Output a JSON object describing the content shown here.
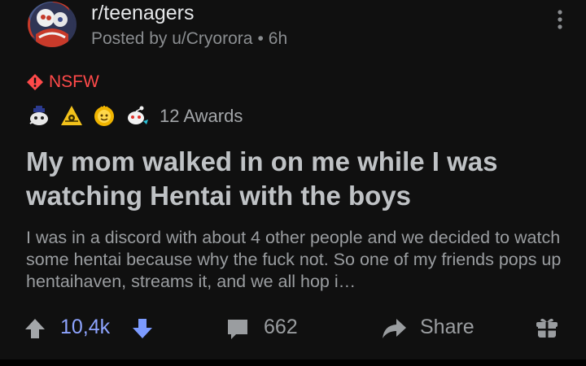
{
  "header": {
    "subreddit": "r/teenagers",
    "posted_by_prefix": "Posted by u/Cryorora",
    "separator": "•",
    "age": "6h",
    "more_icon": "vertical-ellipsis-icon"
  },
  "flair": {
    "label": "NSFW",
    "color": "#ff4a4a",
    "icon": "nsfw-diamond-icon"
  },
  "awards": {
    "icons": [
      "wholesome-award-icon",
      "rocket-like-award-icon",
      "gold-award-icon",
      "snoo-award-icon"
    ],
    "label": "12 Awards"
  },
  "post": {
    "title": "My mom walked in on me while I was watching Hentai with the boys",
    "body": "I was in a discord with about 4 other people and we decided to watch some hentai because why the fuck not. So one of my friends pops up hentaihaven, streams it, and we all hop i…"
  },
  "actions": {
    "score": "10,4k",
    "score_color": "#8ea4ff",
    "comments": "662",
    "share": "Share",
    "icons": [
      "upvote-icon",
      "downvote-icon",
      "comment-icon",
      "share-icon",
      "gift-icon"
    ]
  }
}
